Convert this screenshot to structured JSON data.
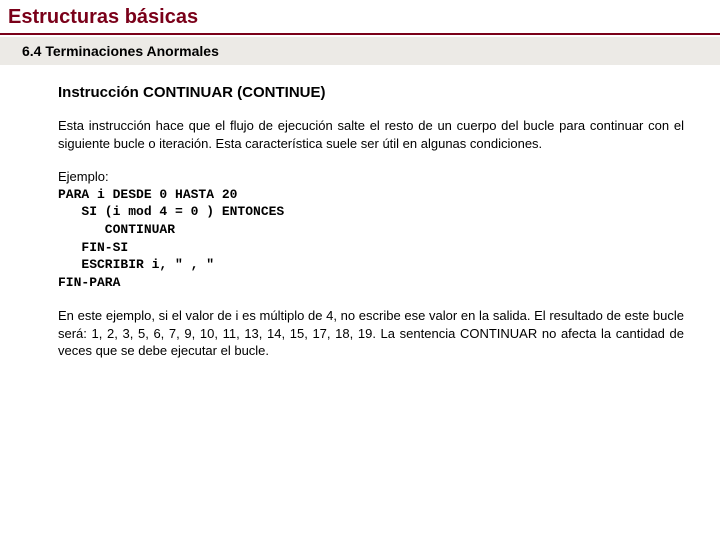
{
  "page_title": "Estructuras básicas",
  "section_number_title": "6.4 Terminaciones Anormales",
  "sub_title": "Instrucción CONTINUAR (CONTINUE)",
  "description": "Esta instrucción hace que el flujo de ejecución salte el resto de un cuerpo del bucle para continuar con el siguiente bucle o iteración. Esta característica suele ser útil en algunas condiciones.",
  "example_label": "Ejemplo:",
  "code_block": "PARA i DESDE 0 HASTA 20\n   SI (i mod 4 = 0 ) ENTONCES\n      CONTINUAR\n   FIN-SI\n   ESCRIBIR i, \" , \"\nFIN-PARA",
  "notes": "En este ejemplo, si el valor de i es múltiplo de 4, no escribe ese valor en la salida.\nEl resultado de este bucle será: 1, 2, 3, 5, 6, 7, 9, 10, 11, 13, 14, 15, 17, 18, 19.\nLa sentencia CONTINUAR no afecta la cantidad de veces que se debe ejecutar el bucle."
}
